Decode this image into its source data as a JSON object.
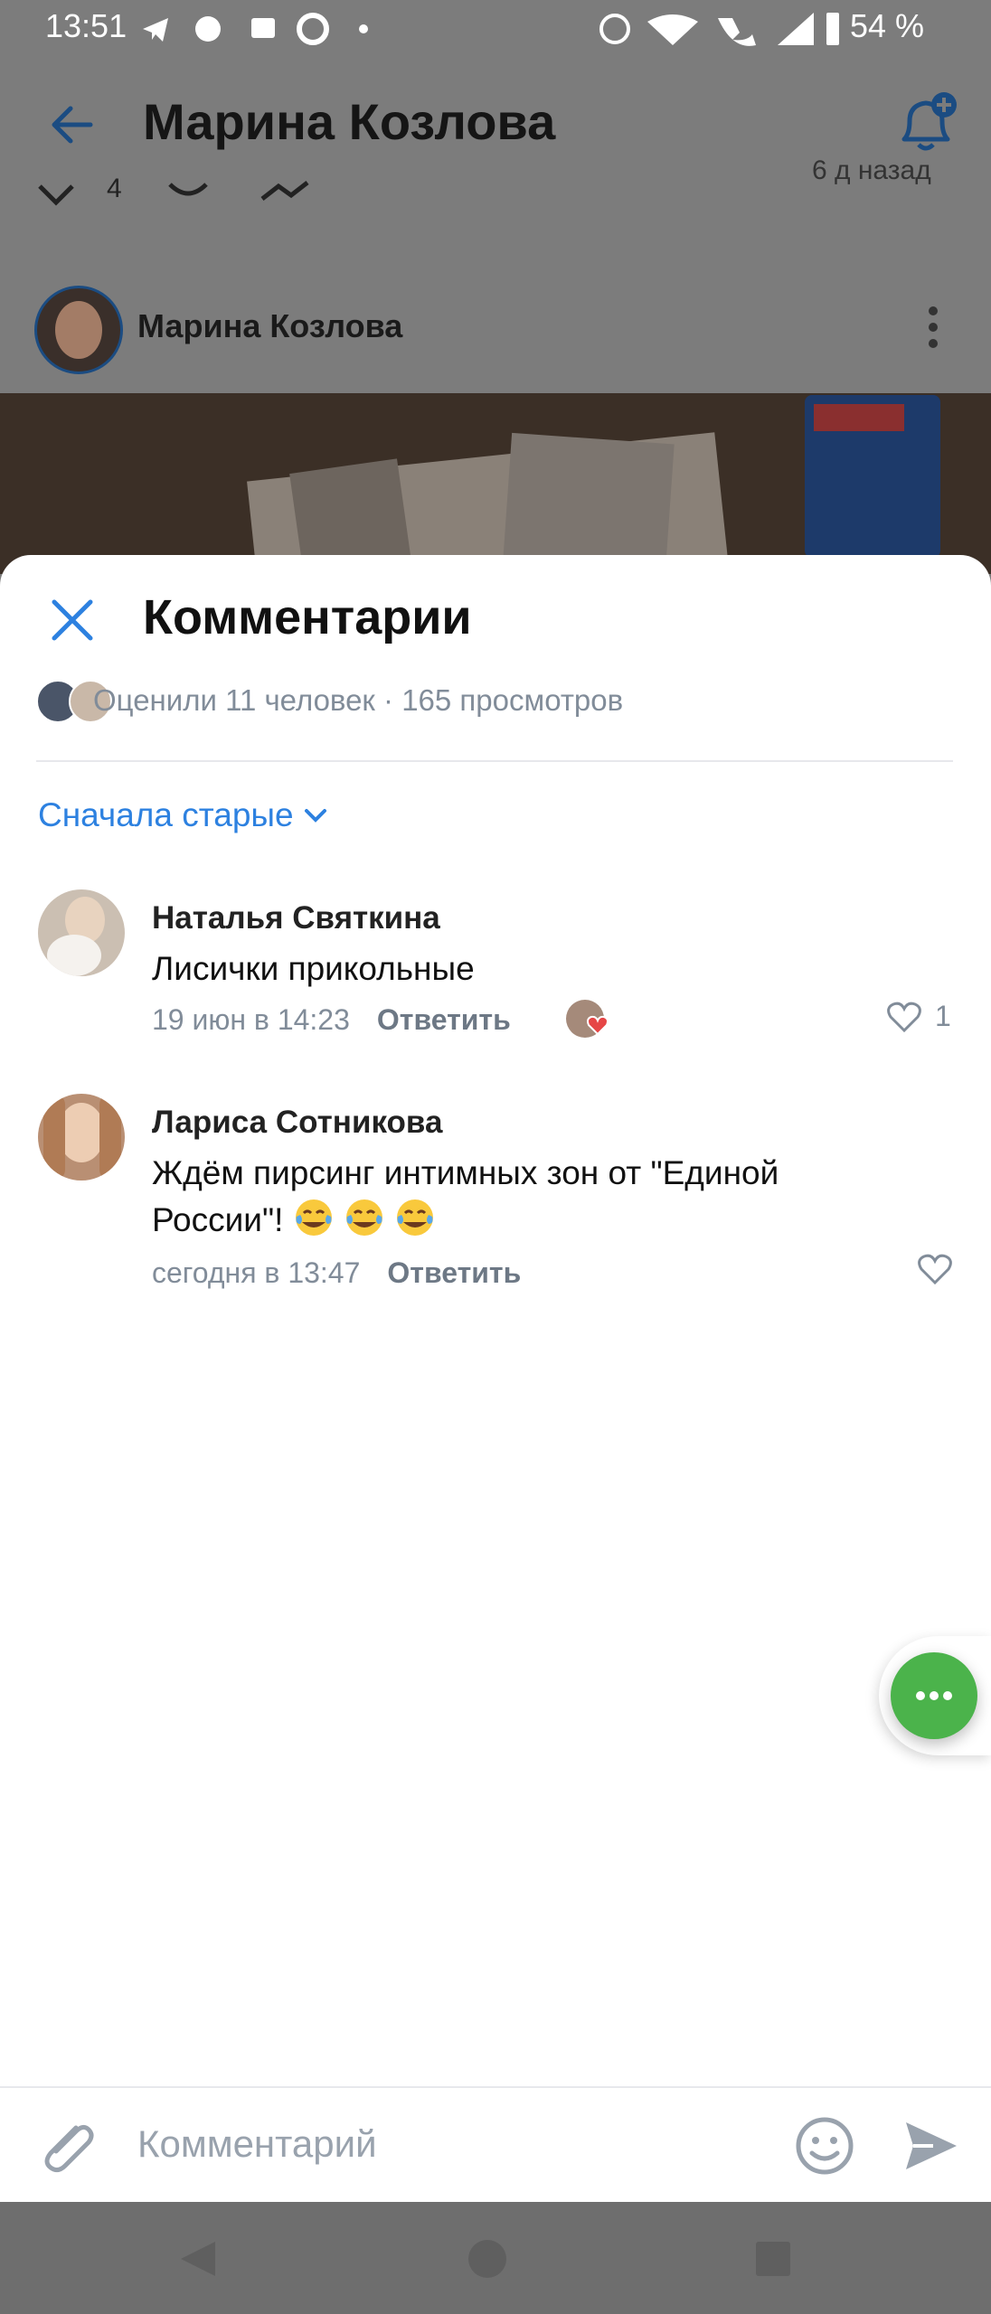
{
  "status_bar": {
    "time": "13:51",
    "battery": "54 %"
  },
  "background": {
    "title": "Марина Козлова",
    "author_name": "Марина Козлова",
    "reactions_count": "4",
    "post_time": "6 д назад"
  },
  "sheet": {
    "title": "Комментарии",
    "likes_summary": "Оценили 11 человек · 165 просмотров",
    "sort_label": "Сначала старые",
    "comments": [
      {
        "author": "Наталья Святкина",
        "text": "Лисички прикольные",
        "time": "19 июн в 14:23",
        "reply": "Ответить",
        "likes": "1"
      },
      {
        "author": "Лариса Сотникова",
        "text": "Ждём пирсинг интимных зон от \"Единой России\"!",
        "time": "сегодня в 13:47",
        "reply": "Ответить",
        "likes": ""
      }
    ]
  },
  "composer": {
    "placeholder": "Комментарий"
  },
  "colors": {
    "accent": "#2d81e0",
    "fab": "#4bb34b",
    "secondary_text": "#818c99"
  }
}
